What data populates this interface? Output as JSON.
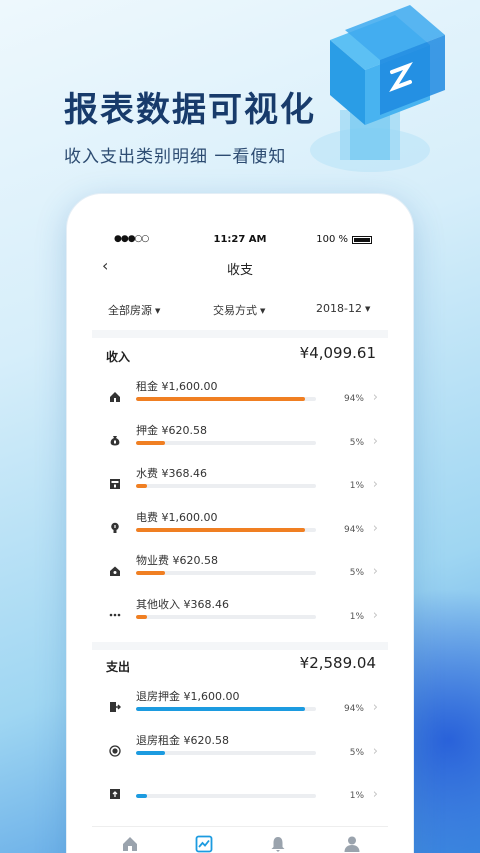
{
  "promo": {
    "headline": "报表数据可视化",
    "subline": "收入支出类别明细 一看便知"
  },
  "status_bar": {
    "signal": "●●●○○",
    "time": "11:27 AM",
    "battery_text": "100 %"
  },
  "nav": {
    "back_icon": "chevron-left-icon",
    "back_glyph": "‹",
    "title": "收支"
  },
  "filters": {
    "property": "全部房源",
    "method": "交易方式",
    "month": "2018-12",
    "caret": "▼"
  },
  "income": {
    "label": "收入",
    "total": "¥4,099.61",
    "bar_color": "#f07f22",
    "items": [
      {
        "label": "租金 ¥1,600.00",
        "pct": "94%",
        "level": 0.94,
        "icon": "house-icon"
      },
      {
        "label": "押金 ¥620.58",
        "pct": "5%",
        "level": 0.16,
        "icon": "money-bag-icon"
      },
      {
        "label": "水费 ¥368.46",
        "pct": "1%",
        "level": 0.06,
        "icon": "water-meter-icon"
      },
      {
        "label": "电费 ¥1,600.00",
        "pct": "94%",
        "level": 0.94,
        "icon": "lightbulb-icon"
      },
      {
        "label": "物业费 ¥620.58",
        "pct": "5%",
        "level": 0.16,
        "icon": "property-icon"
      },
      {
        "label": "其他收入 ¥368.46",
        "pct": "1%",
        "level": 0.06,
        "icon": "more-icon"
      }
    ]
  },
  "expense": {
    "label": "支出",
    "total": "¥2,589.04",
    "bar_color": "#1c9be0",
    "items": [
      {
        "label": "退房押金 ¥1,600.00",
        "pct": "94%",
        "level": 0.94,
        "icon": "exit-door-icon"
      },
      {
        "label": "退房租金 ¥620.58",
        "pct": "5%",
        "level": 0.16,
        "icon": "coin-refund-icon"
      },
      {
        "label": "",
        "pct": "1%",
        "level": 0.06,
        "icon": "upload-box-icon"
      }
    ]
  },
  "tabbar": {
    "active_color": "#1c9be0",
    "inactive_color": "#9aa3ad",
    "tabs": [
      {
        "icon": "home-icon"
      },
      {
        "icon": "chart-icon"
      },
      {
        "icon": "bell-icon"
      },
      {
        "icon": "user-icon"
      }
    ]
  }
}
